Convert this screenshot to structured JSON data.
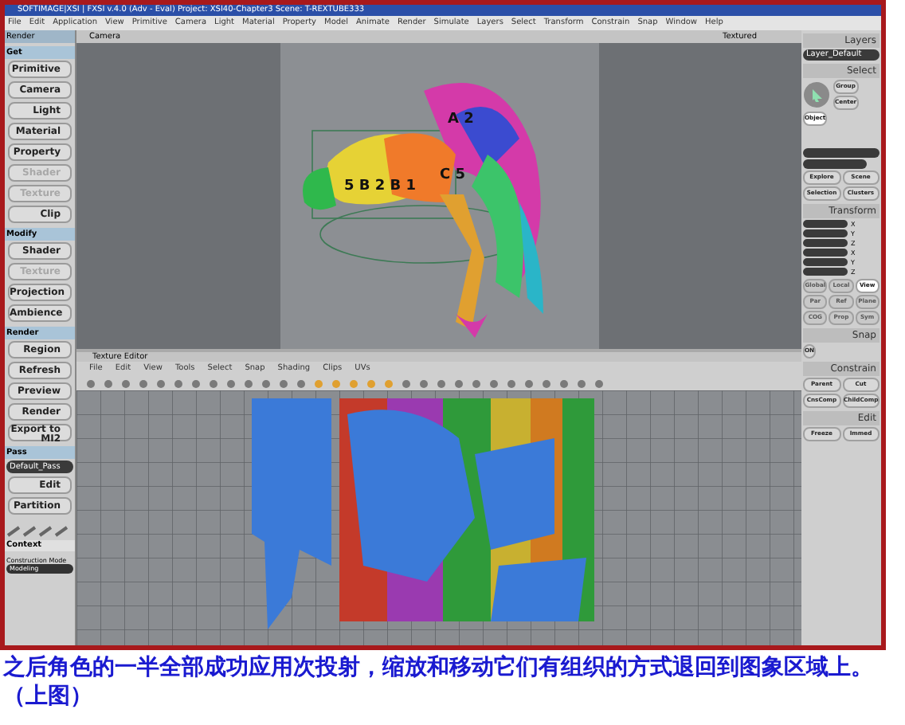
{
  "window": {
    "title": "SOFTIMAGE|XSI | FXSI v.4.0 (Adv - Eval) Project: XSI40-Chapter3   Scene: T-REXTUBE333"
  },
  "menu": [
    "File",
    "Edit",
    "Application",
    "View",
    "Primitive",
    "Camera",
    "Light",
    "Material",
    "Property",
    "Model",
    "Animate",
    "Render",
    "Simulate",
    "Layers",
    "Select",
    "Transform",
    "Constrain",
    "Snap",
    "Window",
    "Help"
  ],
  "left_panel": {
    "header": "Render",
    "sections": [
      {
        "title": "Get",
        "items": [
          {
            "label": "Primitive",
            "disabled": false
          },
          {
            "label": "Camera",
            "disabled": false
          },
          {
            "label": "Light",
            "disabled": false
          },
          {
            "label": "Material",
            "disabled": false
          },
          {
            "label": "Property",
            "disabled": false
          },
          {
            "label": "Shader",
            "disabled": true
          },
          {
            "label": "Texture",
            "disabled": true
          },
          {
            "label": "Clip",
            "disabled": false
          }
        ]
      },
      {
        "title": "Modify",
        "items": [
          {
            "label": "Shader",
            "disabled": false
          },
          {
            "label": "Texture",
            "disabled": true
          },
          {
            "label": "Projection",
            "disabled": false
          },
          {
            "label": "Ambience",
            "disabled": false
          }
        ]
      },
      {
        "title": "Render",
        "items": [
          {
            "label": "Region",
            "disabled": false
          },
          {
            "label": "Refresh",
            "disabled": false
          },
          {
            "label": "Preview",
            "disabled": false
          },
          {
            "label": "Render",
            "disabled": false
          },
          {
            "label": "Export to MI2",
            "disabled": false
          }
        ]
      },
      {
        "title": "Pass",
        "dropdown": "Default_Pass",
        "items": [
          {
            "label": "Edit",
            "disabled": false
          },
          {
            "label": "Partition",
            "disabled": false
          }
        ]
      }
    ],
    "context": "Context",
    "mode_label": "Construction Mode",
    "mode_value": "Modeling"
  },
  "viewport": {
    "camera": "Camera",
    "display": "Textured",
    "texture_labels": [
      "5 B 2 B 1",
      "A 2",
      "C 5"
    ]
  },
  "texture_editor": {
    "title": "Texture Editor",
    "menu": [
      "File",
      "Edit",
      "View",
      "Tools",
      "Select",
      "Snap",
      "Shading",
      "Clips",
      "UVs"
    ]
  },
  "right_panel": {
    "layers": {
      "title": "Layers",
      "value": "Layer_Default"
    },
    "select": {
      "title": "Select",
      "buttons": [
        "Group",
        "Center"
      ],
      "filters": [
        {
          "label": "Object",
          "selected": true
        }
      ],
      "explore": [
        "Explore",
        "Scene",
        "Selection",
        "Clusters"
      ]
    },
    "transform": {
      "title": "Transform",
      "axes": [
        "X",
        "Y",
        "Z",
        "X",
        "Y",
        "Z"
      ],
      "spaces": [
        {
          "label": "Global",
          "selected": false
        },
        {
          "label": "Local",
          "selected": false
        },
        {
          "label": "View",
          "selected": true
        },
        {
          "label": "Par",
          "selected": false
        },
        {
          "label": "Ref",
          "selected": false
        },
        {
          "label": "Plane",
          "selected": false
        },
        {
          "label": "COG",
          "selected": false
        },
        {
          "label": "Prop",
          "selected": false
        },
        {
          "label": "Sym",
          "selected": false
        }
      ]
    },
    "snap": {
      "title": "Snap",
      "toggle": "ON"
    },
    "constrain": {
      "title": "Constrain",
      "buttons": [
        "Parent",
        "Cut",
        "CnsComp",
        "ChildComp"
      ]
    },
    "edit": {
      "title": "Edit",
      "buttons": [
        "Freeze",
        "Immed"
      ]
    }
  },
  "caption": "之后角色的一半全部成功应用次投射，缩放和移动它们有组织的方式退回到图象区域上。（上图）"
}
